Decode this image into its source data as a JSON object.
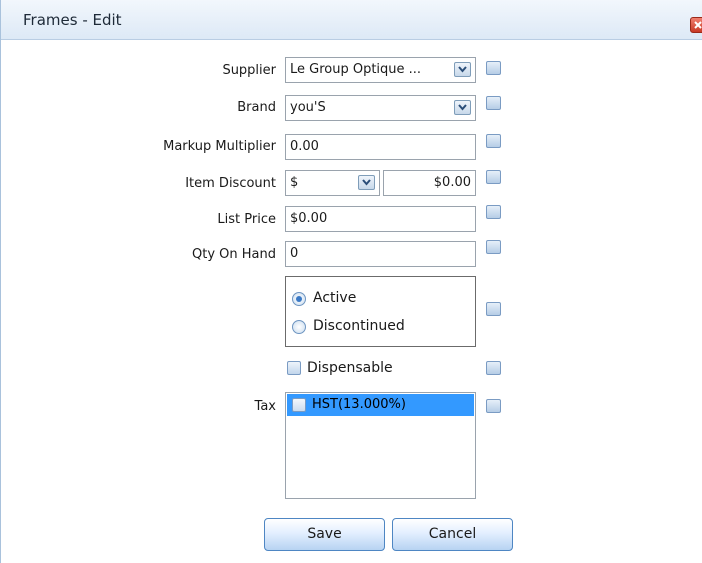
{
  "dialog": {
    "title": "Frames - Edit"
  },
  "form": {
    "supplier": {
      "label": "Supplier",
      "value": "Le Group Optique ..."
    },
    "brand": {
      "label": "Brand",
      "value": "you'S"
    },
    "markup": {
      "label": "Markup Multiplier",
      "value": "0.00"
    },
    "discount": {
      "label": "Item Discount",
      "type_value": "$",
      "amount": "$0.00"
    },
    "list_price": {
      "label": "List Price",
      "value": "$0.00"
    },
    "qty": {
      "label": "Qty On Hand",
      "value": "0"
    },
    "status": {
      "options": [
        "Active",
        "Discontinued"
      ],
      "selected": "Active"
    },
    "dispensable": {
      "label": "Dispensable",
      "checked": false
    },
    "tax": {
      "label": "Tax",
      "items": [
        {
          "label": "HST(13.000%)",
          "checked": false,
          "selected": true
        }
      ]
    }
  },
  "buttons": {
    "save": "Save",
    "cancel": "Cancel"
  },
  "colors": {
    "titlebar": "#dde9f6",
    "selection": "#3399ff",
    "button_border": "#4e86c3"
  }
}
